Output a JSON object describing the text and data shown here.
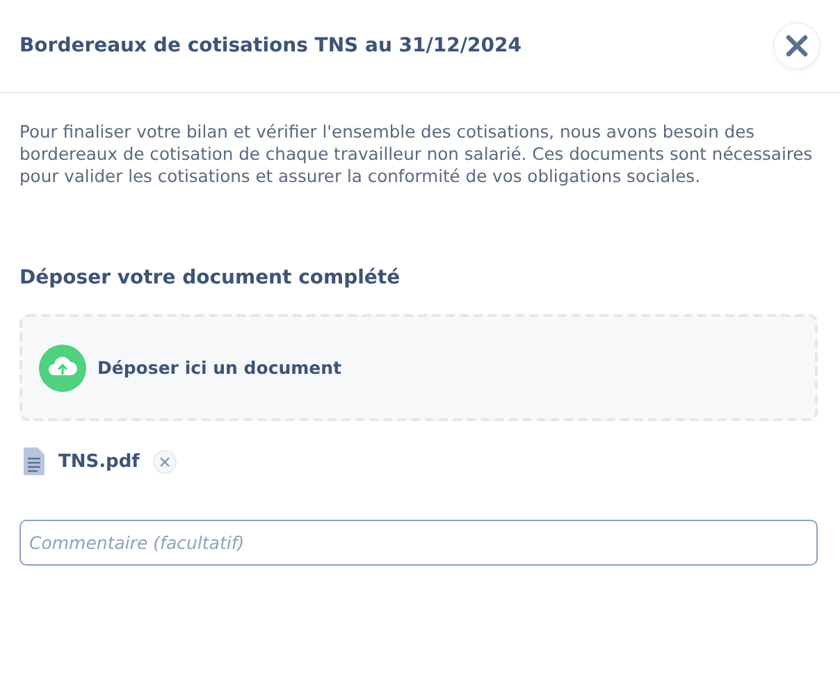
{
  "dialog": {
    "title": "Bordereaux de cotisations TNS au 31/12/2024"
  },
  "description": "Pour finaliser votre bilan et vérifier l'ensemble des cotisations, nous avons besoin des bordereaux de cotisation de chaque travailleur non salarié. Ces documents sont nécessaires pour valider les cotisations et assurer la conformité de vos obligations sociales.",
  "upload": {
    "heading": "Déposer votre document complété",
    "dropzone_label": "Déposer ici un document"
  },
  "files": [
    {
      "name": "TNS.pdf"
    }
  ],
  "comment": {
    "placeholder": "Commentaire (facultatif)"
  }
}
